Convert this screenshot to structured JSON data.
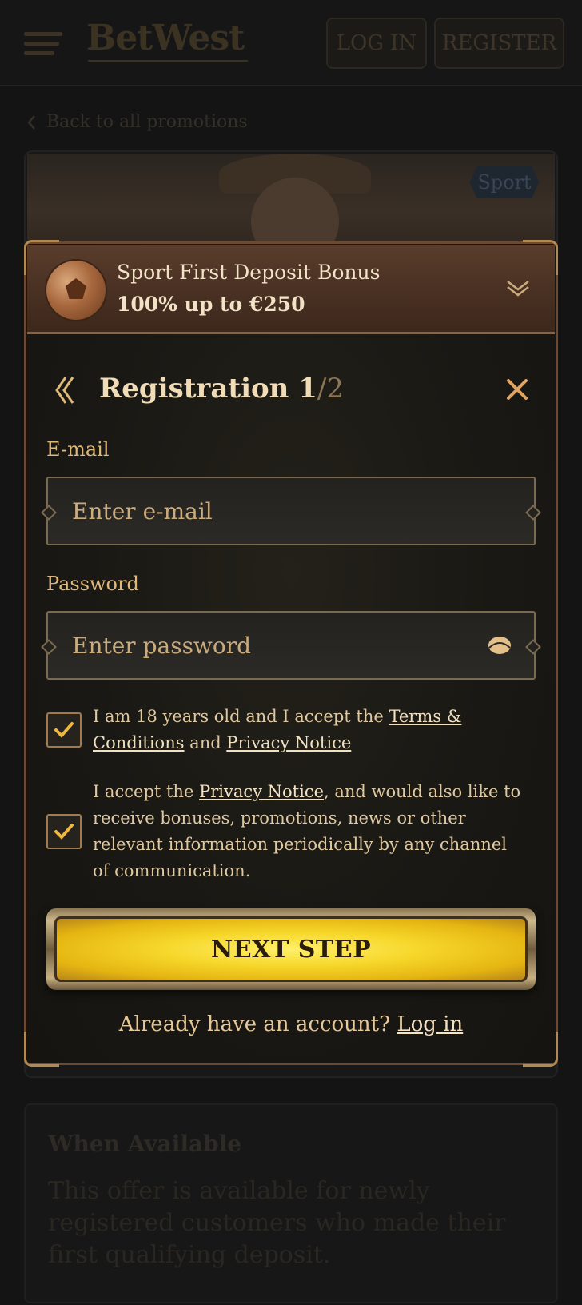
{
  "header": {
    "logo": "BetWest",
    "login_label": "LOG IN",
    "register_label": "REGISTER"
  },
  "back_link": "Back to all promotions",
  "promo": {
    "tag": "Sport"
  },
  "bonus": {
    "title": "Sport First Deposit Bonus",
    "subtitle": "100% up to €250"
  },
  "registration": {
    "title": "Registration",
    "step_current": "1",
    "step_total": "/2",
    "email_label": "E-mail",
    "email_placeholder": "Enter e-mail",
    "email_value": "",
    "password_label": "Password",
    "password_placeholder": "Enter password",
    "password_value": "",
    "consent_age": {
      "checked": true,
      "text_before": "I am 18 years old and I accept the ",
      "terms_link": "Terms & Conditions",
      "text_mid": " and ",
      "privacy_link": "Privacy Notice"
    },
    "consent_marketing": {
      "checked": true,
      "text_before": "I accept the ",
      "privacy_link": "Privacy Notice",
      "text_after": ", and would also like to receive bonuses, promotions, news or other relevant information periodically by any channel of communication."
    },
    "next_button": "NEXT STEP",
    "already_text": "Already have an account? ",
    "login_link": "Log in"
  },
  "when_available": {
    "title": "When Available",
    "text": "This offer is available for newly registered customers who made their first qualifying deposit."
  },
  "colors": {
    "accent_gold": "#e0b97a",
    "button_yellow": "#f6d629",
    "banner_brown": "#4a3123"
  }
}
